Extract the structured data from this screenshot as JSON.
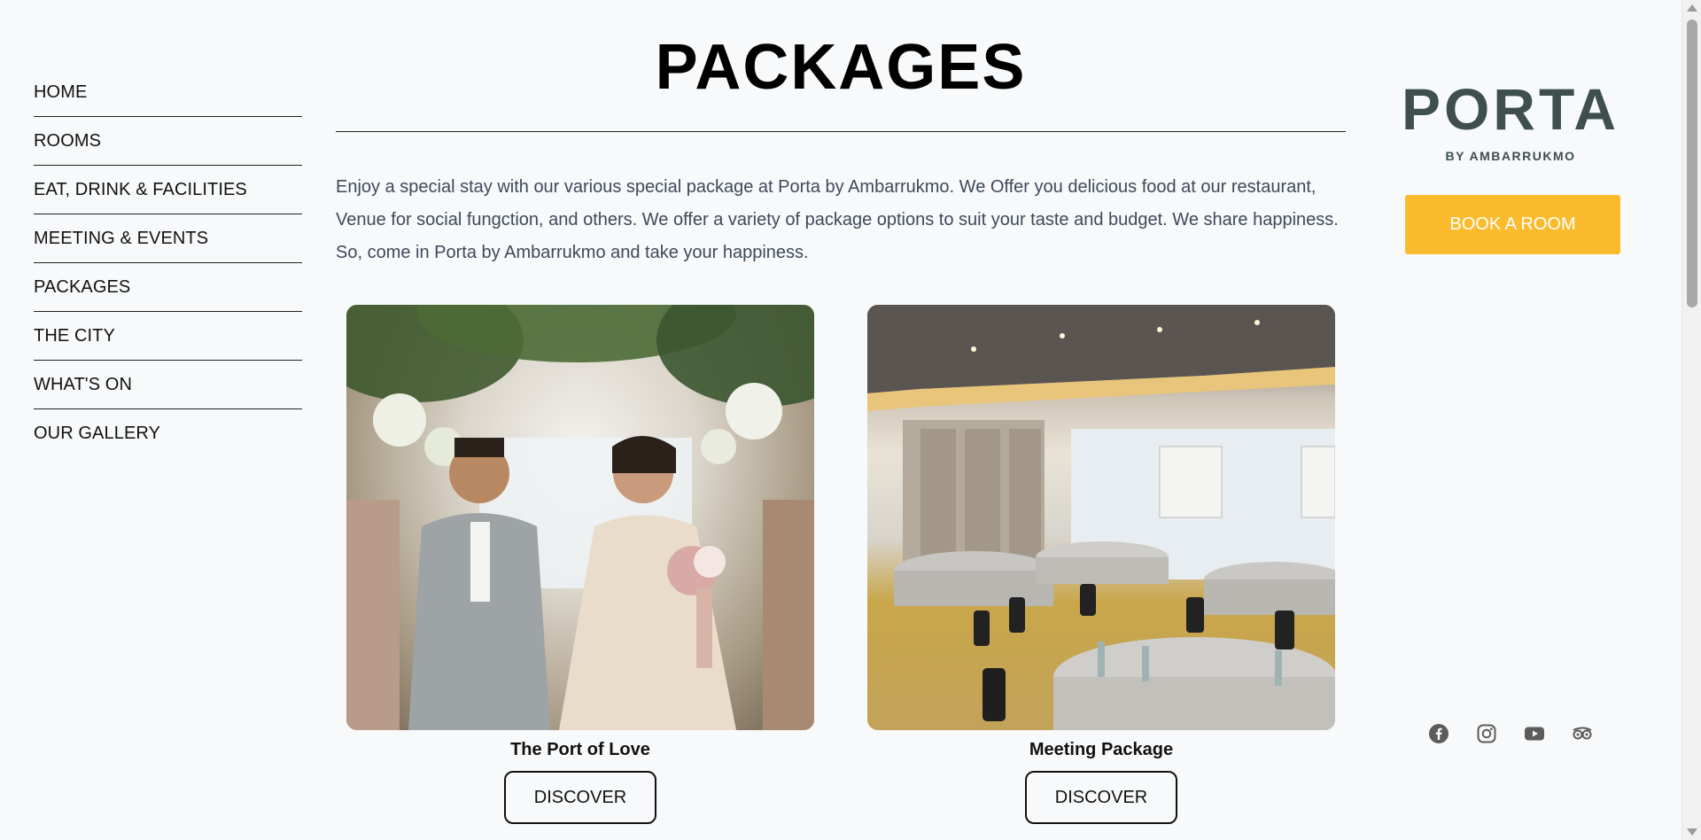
{
  "nav": {
    "items": [
      {
        "label": "HOME"
      },
      {
        "label": "ROOMS"
      },
      {
        "label": "EAT, DRINK & FACILITIES"
      },
      {
        "label": "MEETING & EVENTS"
      },
      {
        "label": "PACKAGES"
      },
      {
        "label": "THE CITY"
      },
      {
        "label": "WHAT'S ON"
      },
      {
        "label": "OUR GALLERY"
      }
    ]
  },
  "main": {
    "title": "PACKAGES",
    "intro": "Enjoy a special stay with our various special package at Porta by Ambarrukmo. We Offer you delicious food at our restaurant, Venue for social fungction, and others. We offer a variety of package options to suit your taste and budget. We share happiness. So, come in Porta by Ambarrukmo and take your happiness.",
    "cards": [
      {
        "title": "The Port of Love",
        "button": "DISCOVER",
        "image": "wedding-couple-photo"
      },
      {
        "title": "Meeting Package",
        "button": "DISCOVER",
        "image": "meeting-room-photo"
      }
    ]
  },
  "sidebar_right": {
    "logo": {
      "word": "PORTA",
      "sub": "BY AMBARRUKMO"
    },
    "book_button": "BOOK A ROOM",
    "social_icons": [
      "facebook-icon",
      "instagram-icon",
      "youtube-icon",
      "tripadvisor-icon"
    ]
  },
  "colors": {
    "accent": "#fbbb2d",
    "logo": "#3e4f4c",
    "background": "#f7f9fb",
    "text": "#3f4a57"
  }
}
